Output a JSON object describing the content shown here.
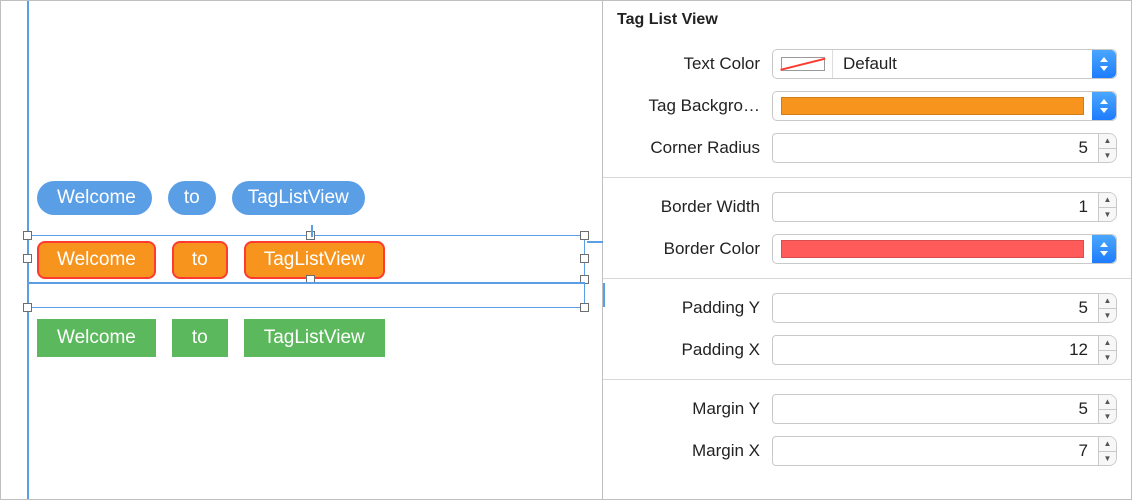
{
  "inspector": {
    "header": "Tag List View",
    "text_color": {
      "label": "Text Color",
      "value_label": "Default"
    },
    "tag_background": {
      "label": "Tag Backgro…",
      "color": "#f7941d"
    },
    "corner_radius": {
      "label": "Corner Radius",
      "value": "5"
    },
    "border_width": {
      "label": "Border Width",
      "value": "1"
    },
    "border_color": {
      "label": "Border Color",
      "color": "#ff5b5b"
    },
    "padding_y": {
      "label": "Padding Y",
      "value": "5"
    },
    "padding_x": {
      "label": "Padding X",
      "value": "12"
    },
    "margin_y": {
      "label": "Margin Y",
      "value": "5"
    },
    "margin_x": {
      "label": "Margin X",
      "value": "7"
    }
  },
  "canvas": {
    "rows": [
      {
        "style": "pill",
        "tags": [
          "Welcome",
          "to",
          "TagListView"
        ]
      },
      {
        "style": "round",
        "tags": [
          "Welcome",
          "to",
          "TagListView"
        ]
      },
      {
        "style": "square",
        "tags": [
          "Welcome",
          "to",
          "TagListView"
        ]
      }
    ]
  }
}
